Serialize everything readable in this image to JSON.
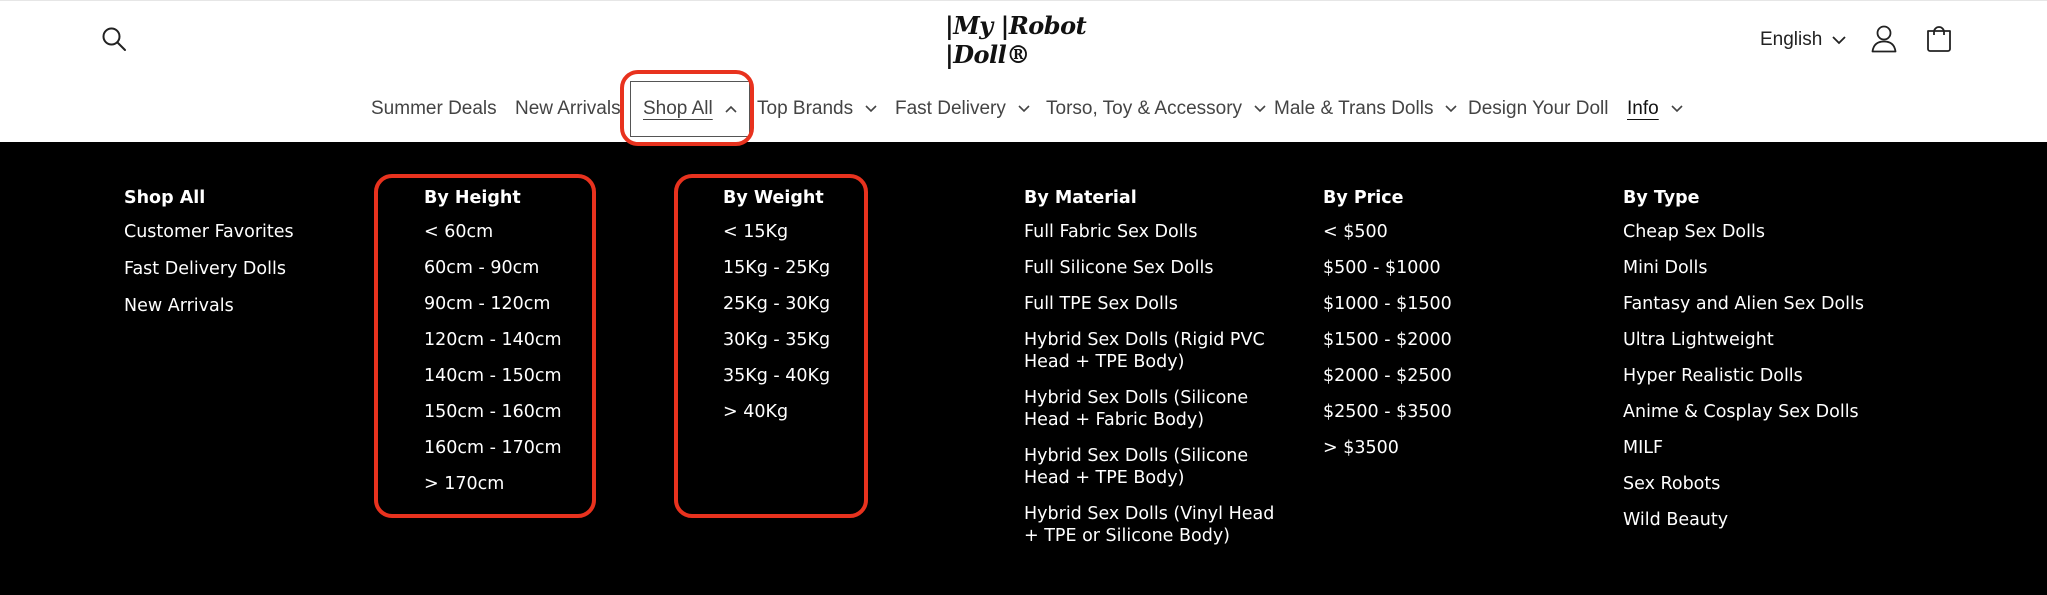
{
  "header": {
    "logo_text": "|My |Robot |Doll®",
    "language": "English"
  },
  "nav": {
    "items": [
      {
        "label": "Summer Deals"
      },
      {
        "label": "New Arrivals"
      },
      {
        "label": "Shop All"
      },
      {
        "label": "Top Brands"
      },
      {
        "label": "Fast Delivery"
      },
      {
        "label": "Torso, Toy & Accessory"
      },
      {
        "label": "Male & Trans Dolls"
      },
      {
        "label": "Design Your Doll"
      },
      {
        "label": "Info"
      }
    ]
  },
  "mega_menu": {
    "columns": [
      {
        "heading": "Shop All",
        "links": [
          "Customer Favorites",
          "Fast Delivery Dolls",
          "New Arrivals"
        ]
      },
      {
        "heading": "By Height",
        "links": [
          "< 60cm",
          "60cm - 90cm",
          "90cm - 120cm",
          "120cm - 140cm",
          "140cm - 150cm",
          "150cm - 160cm",
          "160cm - 170cm",
          "> 170cm"
        ]
      },
      {
        "heading": "By Weight",
        "links": [
          "< 15Kg",
          "15Kg - 25Kg",
          "25Kg - 30Kg",
          "30Kg - 35Kg",
          "35Kg - 40Kg",
          "> 40Kg"
        ]
      },
      {
        "heading": "By Material",
        "links": [
          "Full Fabric Sex Dolls",
          "Full Silicone Sex Dolls",
          "Full TPE Sex Dolls",
          "Hybrid Sex Dolls (Rigid PVC Head + TPE Body)",
          "Hybrid Sex Dolls (Silicone Head + Fabric Body)",
          "Hybrid Sex Dolls (Silicone Head + TPE Body)",
          "Hybrid Sex Dolls (Vinyl Head + TPE or Silicone Body)"
        ]
      },
      {
        "heading": "By Price",
        "links": [
          "< $500",
          "$500 - $1000",
          "$1000 - $1500",
          "$1500 - $2000",
          "$2000 - $2500",
          "$2500 - $3500",
          "> $3500"
        ]
      },
      {
        "heading": "By Type",
        "links": [
          "Cheap Sex Dolls",
          "Mini Dolls",
          "Fantasy and Alien Sex Dolls",
          "Ultra Lightweight",
          "Hyper Realistic Dolls",
          "Anime & Cosplay Sex Dolls",
          "MILF",
          "Sex Robots",
          "Wild Beauty"
        ]
      }
    ]
  },
  "colors": {
    "highlight": "#e8321e",
    "menu_bg": "#000000",
    "menu_text": "#ffffff"
  }
}
